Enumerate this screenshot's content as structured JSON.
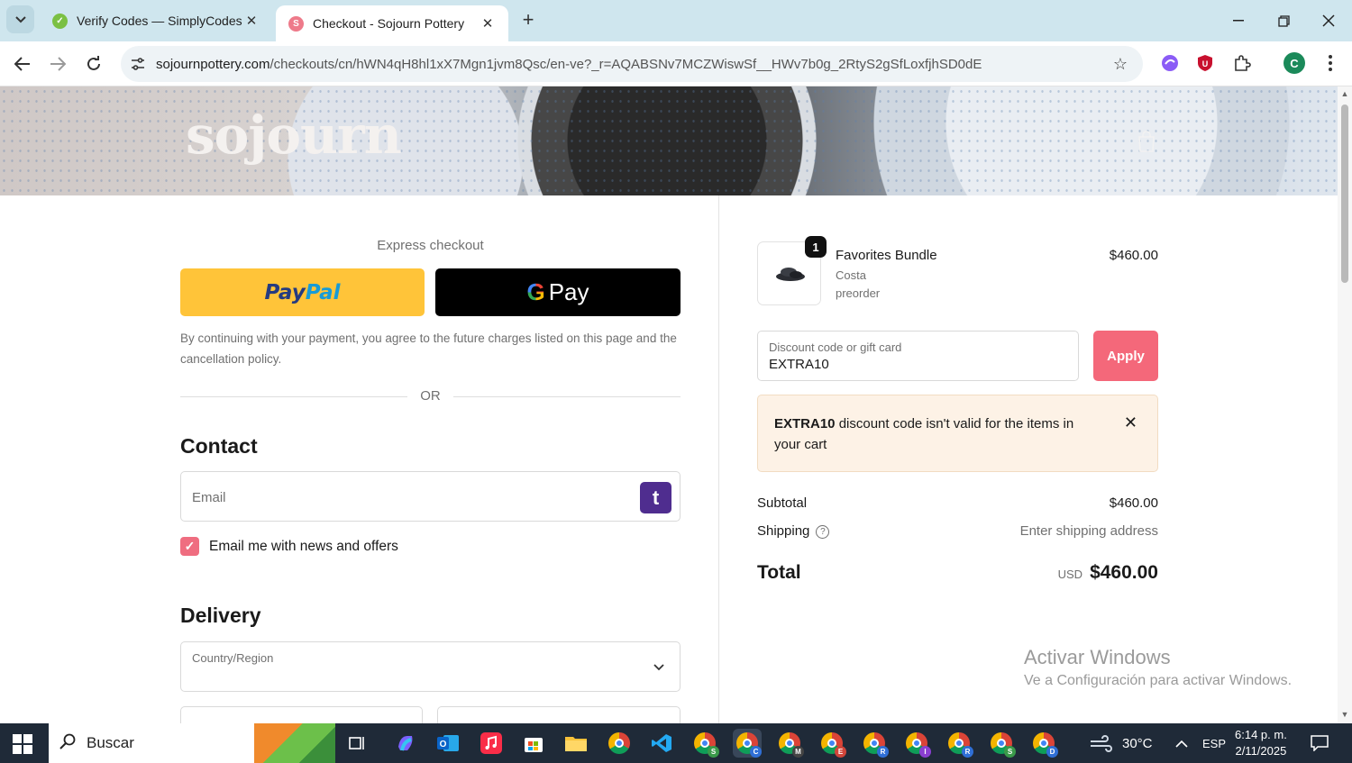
{
  "browser": {
    "tabs": [
      {
        "title": "Verify Codes — SimplyCodes",
        "active": false,
        "favicon_color": "#7bc043"
      },
      {
        "title": "Checkout - Sojourn Pottery",
        "active": true,
        "favicon_color": "#ee7a8a"
      }
    ],
    "url_host": "sojournpottery.com",
    "url_path": "/checkouts/cn/hWN4qH8hl1xX7Mgn1jvm8Qsc/en-ve?_r=AQABSNv7MCZWiswSf__HWv7b0g_2RtyS2gSfLoxfjhSD0dE",
    "profile_initial": "C"
  },
  "store": {
    "logo": "sojourn"
  },
  "checkout": {
    "express_label": "Express checkout",
    "paypal_label_a": "Pay",
    "paypal_label_b": "Pal",
    "gpay_g": "G",
    "gpay_label": "Pay",
    "terms": "By continuing with your payment, you agree to the future charges listed on this page and the cancellation policy.",
    "or_label": "OR",
    "contact_heading": "Contact",
    "email_placeholder": "Email",
    "email_badge": "t",
    "news_checkbox_label": "Email me with news and offers",
    "news_checked": true,
    "delivery_heading": "Delivery",
    "country_label": "Country/Region"
  },
  "summary": {
    "item": {
      "quantity": "1",
      "name": "Favorites Bundle",
      "variant": "Costa",
      "note": "preorder",
      "price": "$460.00"
    },
    "discount_label": "Discount code or gift card",
    "discount_value": "EXTRA10",
    "apply_label": "Apply",
    "error_code": "EXTRA10",
    "error_text": " discount code isn't valid for the items in your cart",
    "subtotal_label": "Subtotal",
    "subtotal_value": "$460.00",
    "shipping_label": "Shipping",
    "shipping_value": "Enter shipping address",
    "total_label": "Total",
    "total_currency": "USD",
    "total_value": "$460.00",
    "accent_color": "#f4687a"
  },
  "watermark": {
    "line1": "Activar Windows",
    "line2": "Ve a Configuración para activar Windows."
  },
  "taskbar": {
    "search_label": "Buscar",
    "temperature": "30°C",
    "language": "ESP",
    "time": "6:14 p. m.",
    "date": "2/11/2025",
    "chrome_profiles": [
      "S",
      "C",
      "M",
      "E",
      "R",
      "I",
      "R",
      "S",
      "D"
    ]
  }
}
